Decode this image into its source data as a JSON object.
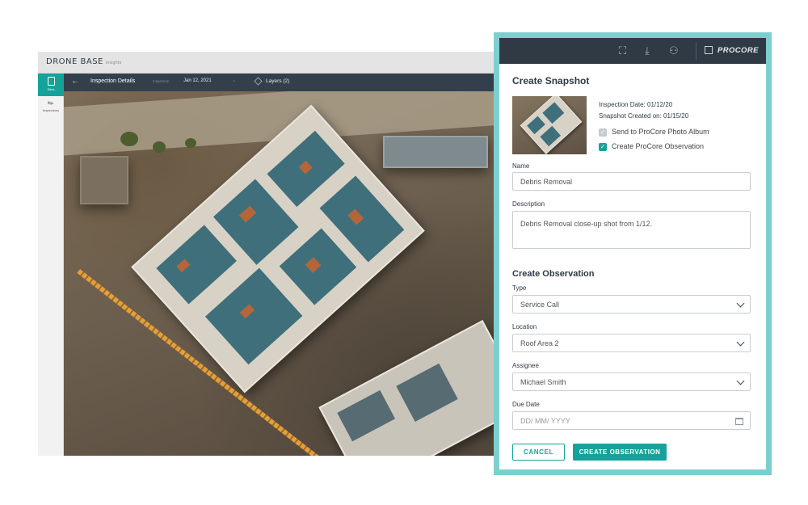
{
  "app": {
    "brand": "DRONE BASE",
    "brand_sub": "insights",
    "nav": [
      {
        "label": "Sites",
        "icon": "clipboard-icon"
      },
      {
        "label": "Inspections",
        "icon": "pencil-icon"
      }
    ],
    "toolbar": {
      "title": "Inspection Details",
      "inspection_label": "Inspection",
      "inspection_date": "Jan 12, 2021",
      "layers_label": "Layers (2)"
    }
  },
  "dialog": {
    "topbar": {
      "icons": [
        "screenshot-icon",
        "download-icon",
        "add-user-icon",
        "external-link-icon"
      ],
      "procore_label": "PROCORE"
    },
    "title": "Create Snapshot",
    "inspection_date": "Inspection Date: 01/12/20",
    "snapshot_created": "Snapshot Created on: 01/15/20",
    "checkboxes": [
      {
        "label": "Send to ProCore Photo Album",
        "checked": false
      },
      {
        "label": "Create ProCore Observation",
        "checked": true
      }
    ],
    "name_label": "Name",
    "name_value": "Debris Removal",
    "description_label": "Description",
    "description_value": "Debris Removal close-up shot from 1/12.",
    "observation_title": "Create Observation",
    "type_label": "Type",
    "type_value": "Service Call",
    "location_label": "Location",
    "location_value": "Roof Area 2",
    "assignee_label": "Assignee",
    "assignee_value": "Michael Smith",
    "due_date_label": "Due Date",
    "due_date_placeholder": "DD/ MM/ YYYY",
    "cancel_label": "CANCEL",
    "create_label": "CREATE OBSERVATION"
  },
  "colors": {
    "accent": "#16a29a",
    "dialog_border": "#7ccfcf",
    "dark_bar": "#2f3a45"
  }
}
